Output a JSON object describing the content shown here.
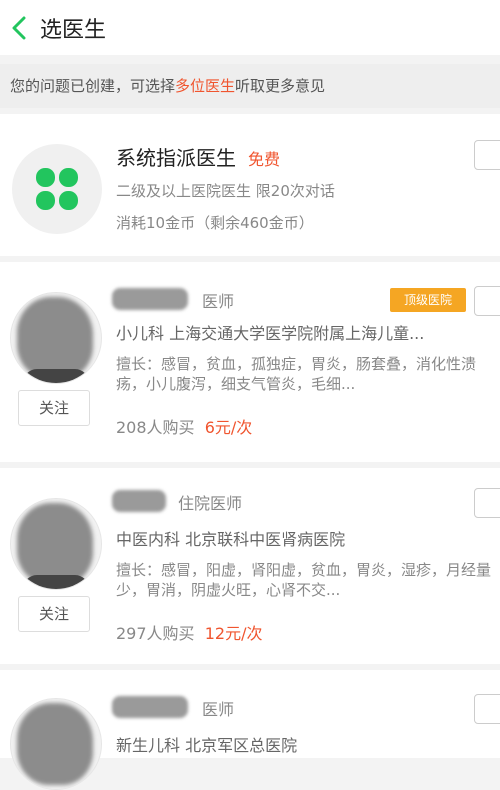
{
  "header": {
    "title": "选医生"
  },
  "notice": {
    "prefix": "您的问题已创建，可选择",
    "highlight": "多位医生",
    "suffix": "听取更多意见"
  },
  "system_doctor": {
    "name": "系统指派医生",
    "tag": "免费",
    "desc": "二级及以上医院医生 限20次对话",
    "cost": "消耗10金币（剩余460金币）"
  },
  "doctors": [
    {
      "role": "医师",
      "badge": "顶级医院",
      "dept": "小儿科  上海交通大学医学院附属上海儿童...",
      "skill": "擅长：感冒，贫血，孤独症，胃炎，肠套叠，消化性溃疡，小儿腹泻，细支气管炎，毛细...",
      "buyers": "208人购买",
      "price": "6元/次",
      "follow": "关注"
    },
    {
      "role": "住院医师",
      "dept": "中医内科  北京联科中医肾病医院",
      "skill": "擅长：感冒，阳虚，肾阳虚，贫血，胃炎，湿疹，月经量少，胃消，阴虚火旺，心肾不交...",
      "buyers": "297人购买",
      "price": "12元/次",
      "follow": "关注"
    },
    {
      "role": "医师",
      "dept": "新生儿科  北京军区总医院"
    }
  ],
  "colors": {
    "accent": "#f0552f",
    "brand_green": "#22c55e",
    "badge": "#f5a623"
  }
}
